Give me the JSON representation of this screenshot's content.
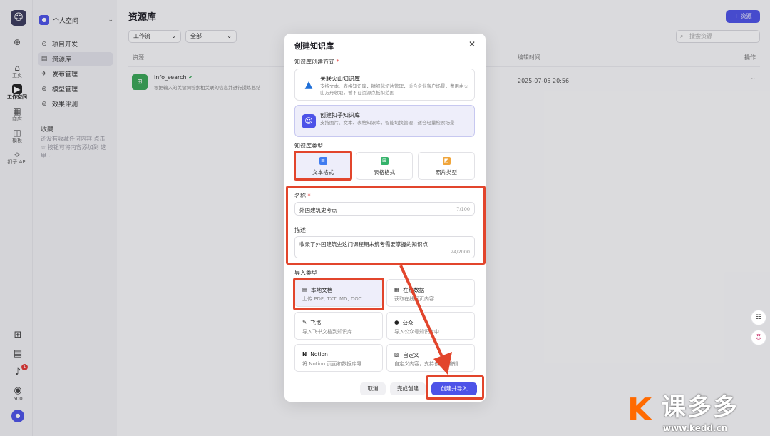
{
  "rail": {
    "items": [
      {
        "glyph": "⊕",
        "label": ""
      },
      {
        "glyph": "⌂",
        "label": "主页"
      },
      {
        "glyph": "▶",
        "label": "工作空间"
      },
      {
        "glyph": "▦",
        "label": "商店"
      },
      {
        "glyph": "◫",
        "label": "模板"
      },
      {
        "glyph": "⟡",
        "label": "扣子 API"
      }
    ],
    "bottom": [
      {
        "glyph": "⊞"
      },
      {
        "glyph": "▤"
      },
      {
        "glyph": "♪",
        "badge": "1"
      },
      {
        "glyph": "◉",
        "label": "500"
      },
      {
        "glyph": "●"
      }
    ]
  },
  "sidebar": {
    "space_name": "个人空间",
    "items": [
      {
        "icon": "⊙",
        "label": "项目开发"
      },
      {
        "icon": "▤",
        "label": "资源库"
      },
      {
        "icon": "✈",
        "label": "发布管理"
      },
      {
        "icon": "⊛",
        "label": "模型管理"
      },
      {
        "icon": "⊚",
        "label": "效果评测"
      }
    ],
    "favorites_title": "收藏",
    "favorites_empty": "还没有收藏任何内容 点击 ☆ 按钮可将内容添加到 这里~"
  },
  "main": {
    "title": "资源库",
    "add_button": "+ 资源",
    "filter_type": "工作流",
    "filter_scope": "全部",
    "search_placeholder": "搜索资源",
    "columns": {
      "resource": "资源",
      "edit_time": "编辑时间",
      "actions": "操作"
    },
    "rows": [
      {
        "name": "info_search",
        "desc": "根据输入的关键词检索相关联的信息并进行提炼总结",
        "time": "2025-07-05 20:56",
        "more": "···"
      }
    ]
  },
  "modal": {
    "title": "创建知识库",
    "close": "✕",
    "method_label": "知识库创建方式",
    "req": "*",
    "methods": [
      {
        "title": "关联火山知识库",
        "desc": "支持文本、表格知识库，精细化切片管理，适合企业客户场景，费用由火山方舟收取，暂不在资源点抵扣范围"
      },
      {
        "title": "创建扣子知识库",
        "desc": "支持图片、文本、表格知识库，智能切换管理，适合轻量检索场景"
      }
    ],
    "type_label": "知识库类型",
    "types": [
      {
        "label": "文本格式",
        "color": "#3f7cf0",
        "glyph": "≡"
      },
      {
        "label": "表格格式",
        "color": "#35b36b",
        "glyph": "⊞"
      },
      {
        "label": "照片类型",
        "color": "#f0a53a",
        "glyph": "◩"
      }
    ],
    "name_label": "名称",
    "name_value": "外国建筑史考点",
    "name_count": "7/100",
    "desc_label": "描述",
    "desc_value": "收录了外国建筑史这门课程期末统考需要掌握的知识点",
    "desc_count": "24/2000",
    "import_label": "导入类型",
    "imports": [
      {
        "icon": "▤",
        "title": "本地文档",
        "desc": "上传 PDF, TXT, MD, DOC..."
      },
      {
        "icon": "▦",
        "title": "在线数据",
        "desc": "获取在线网页内容"
      },
      {
        "icon": "✎",
        "title": "飞书",
        "desc": "导入飞书文档到知识库"
      },
      {
        "icon": "●",
        "title": "公众",
        "desc": "导入公众号知识库中"
      },
      {
        "icon": "N",
        "title": "Notion",
        "desc": "将 Notion 页面和数据库导..."
      },
      {
        "icon": "▧",
        "title": "自定义",
        "desc": "自定义内容，支持创建&编辑"
      }
    ],
    "buttons": {
      "cancel": "取消",
      "finish": "完成创建",
      "create_import": "创建并导入"
    }
  },
  "float_buttons": [
    "☷",
    "☺"
  ],
  "watermark": {
    "mark": "K",
    "text": "课多多",
    "url": "www.kedd.cn"
  },
  "colors": {
    "accent": "#4d53e8",
    "annotation": "#e2452c"
  }
}
